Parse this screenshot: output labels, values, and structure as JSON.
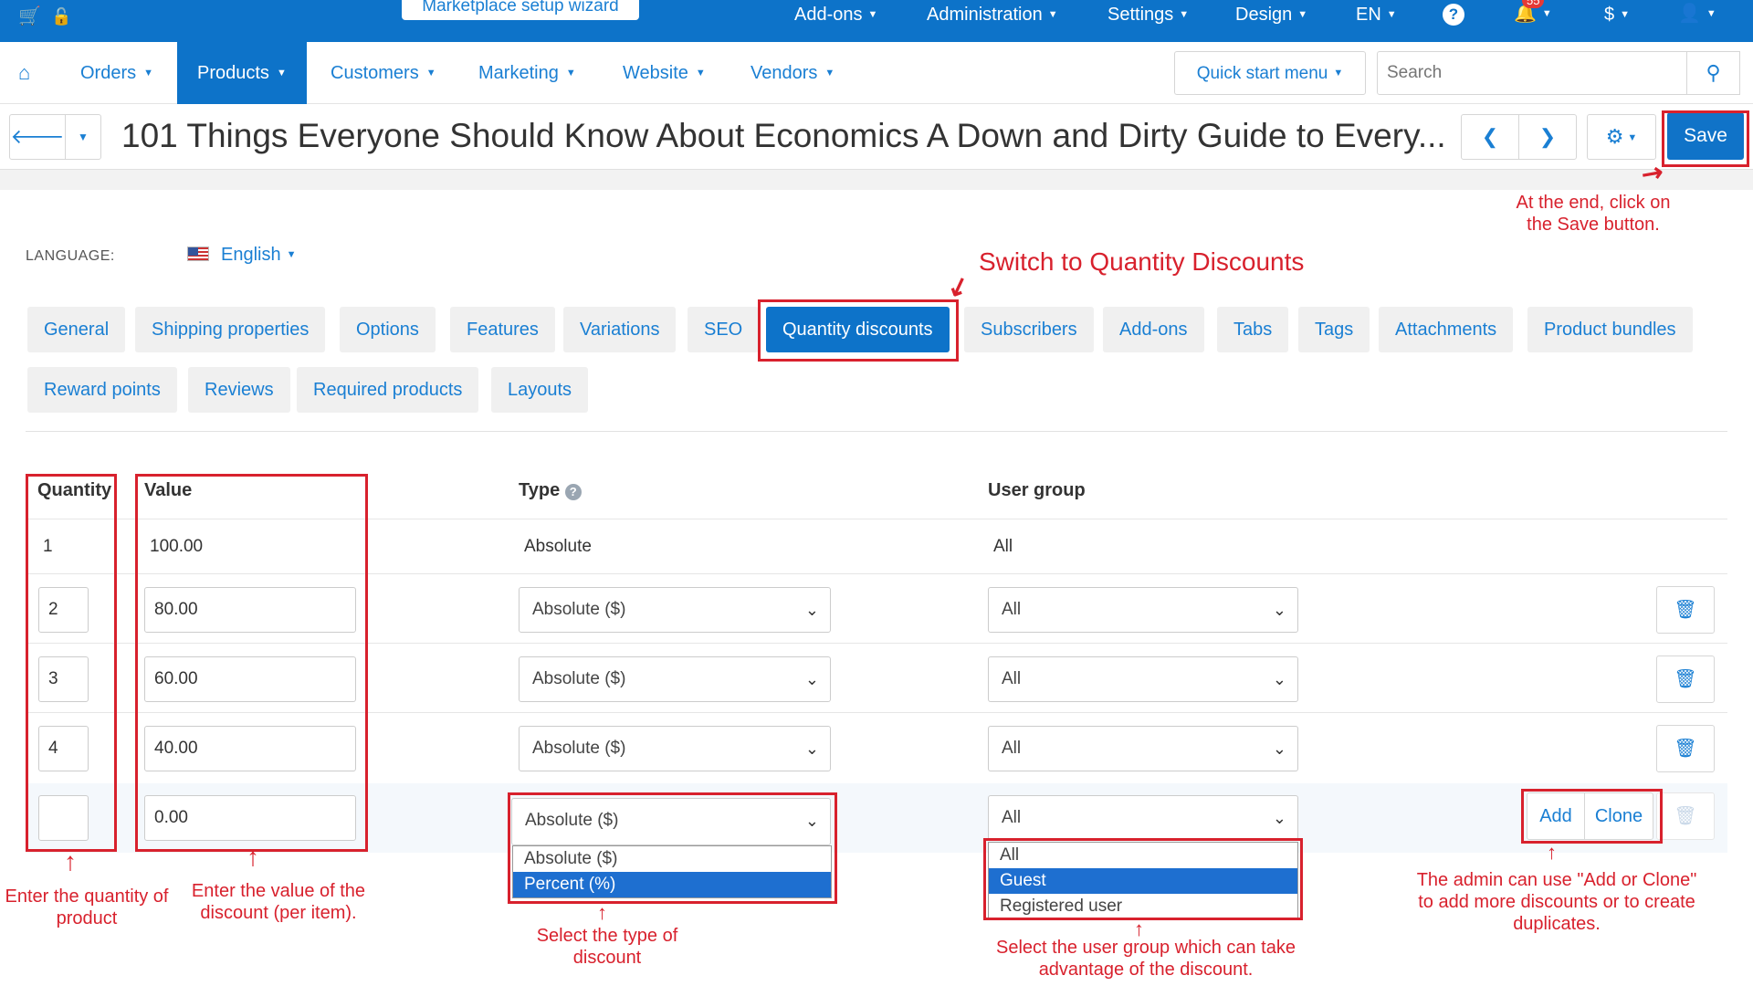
{
  "topbar": {
    "wizard_label": "Marketplace setup wizard",
    "addons": "Add-ons",
    "administration": "Administration",
    "settings": "Settings",
    "design": "Design",
    "language": "EN",
    "help_icon": "?",
    "notifications_count": "55",
    "currency": "$"
  },
  "nav": {
    "items": [
      "Orders",
      "Products",
      "Customers",
      "Marketing",
      "Website",
      "Vendors"
    ],
    "active": "Products",
    "quick_start": "Quick start menu",
    "search_placeholder": "Search"
  },
  "page": {
    "title": "101 Things Everyone Should Know About Economics A Down and Dirty Guide to Every...",
    "save_label": "Save"
  },
  "language": {
    "label": "LANGUAGE:",
    "value": "English"
  },
  "tabs": {
    "row1": [
      "General",
      "Shipping properties",
      "Options",
      "Features",
      "Variations",
      "SEO",
      "Quantity discounts",
      "Subscribers",
      "Add-ons",
      "Tabs",
      "Tags",
      "Attachments",
      "Product bundles"
    ],
    "row2": [
      "Reward points",
      "Reviews",
      "Required products",
      "Layouts"
    ],
    "active": "Quantity discounts"
  },
  "table": {
    "headers": {
      "quantity": "Quantity",
      "value": "Value",
      "type": "Type",
      "user_group": "User group"
    },
    "base_row": {
      "quantity": "1",
      "value": "100.00",
      "type": "Absolute",
      "user_group": "All"
    },
    "rows": [
      {
        "quantity": "2",
        "value": "80.00",
        "type": "Absolute ($)",
        "user_group": "All"
      },
      {
        "quantity": "3",
        "value": "60.00",
        "type": "Absolute ($)",
        "user_group": "All"
      },
      {
        "quantity": "4",
        "value": "40.00",
        "type": "Absolute ($)",
        "user_group": "All"
      }
    ],
    "new_row": {
      "quantity": "",
      "value": "0.00",
      "type": "Absolute ($)",
      "user_group": "All"
    },
    "type_options": [
      "Absolute ($)",
      "Percent (%)"
    ],
    "type_highlighted": "Percent (%)",
    "user_group_options": [
      "All",
      "Guest",
      "Registered user"
    ],
    "user_group_highlighted": "Guest",
    "add_label": "Add",
    "clone_label": "Clone"
  },
  "annotations": {
    "switch_tab": "Switch  to Quantity  Discounts",
    "save_note": "At the end, click on the Save button.",
    "quantity_note": "Enter the quantity of product",
    "value_note": "Enter the value of the discount (per item).",
    "type_note": "Select the type of discount",
    "usergroup_note": "Select the user group which can take advantage of the discount.",
    "addclone_note": "The admin can use \"Add or Clone\" to add more discounts or to create duplicates."
  },
  "colors": {
    "brand_blue": "#0d73c9",
    "annotation_red": "#d8212d"
  }
}
